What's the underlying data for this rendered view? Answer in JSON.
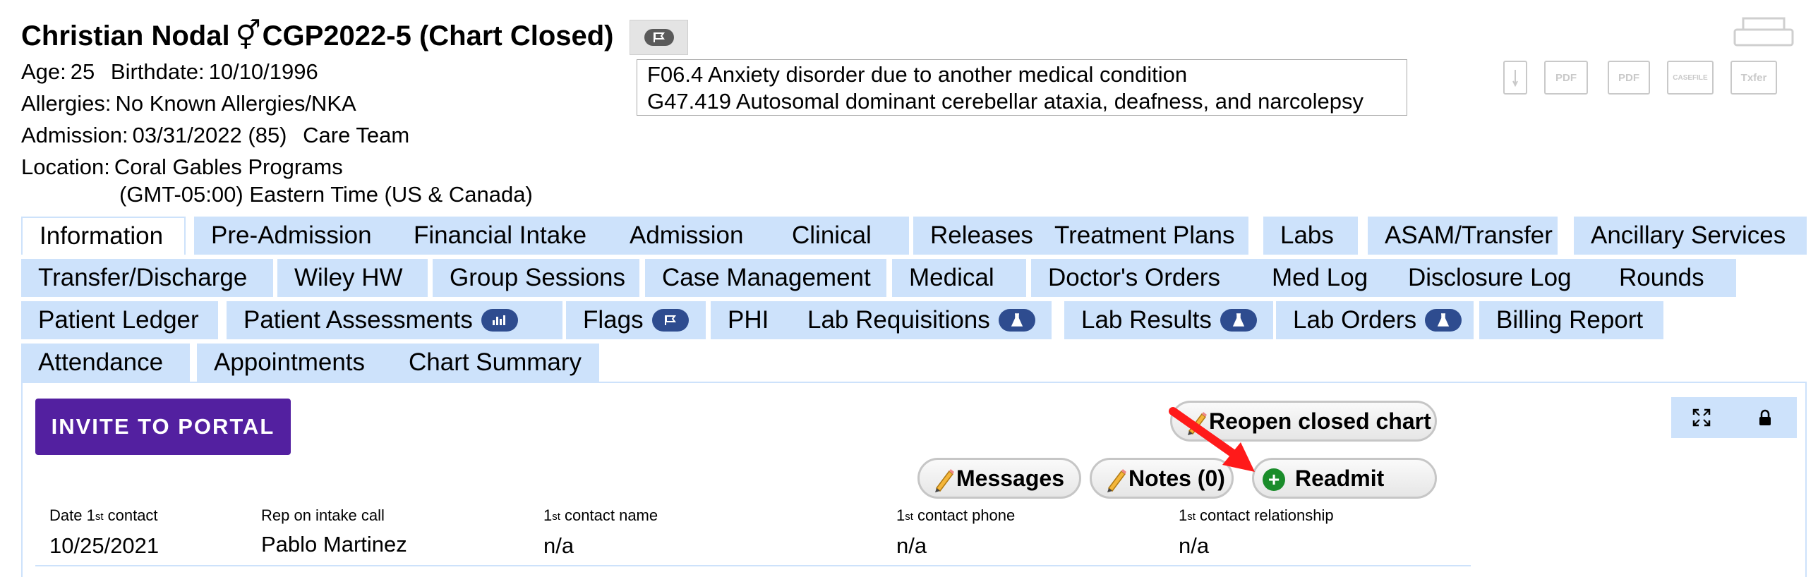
{
  "patient": {
    "name": "Christian Nodal",
    "gender_symbol": "⚥",
    "chart_id": "CGP2022-5 (Chart Closed)",
    "age_label": "Age:",
    "age": "25",
    "birthdate_label": "Birthdate:",
    "birthdate": "10/10/1996",
    "allergies_label": "Allergies:",
    "allergies": "No Known Allergies/NKA",
    "admission_label": "Admission:",
    "admission": "03/31/2022 (85)",
    "care_team": "Care Team",
    "location_label": "Location:",
    "location": "Coral Gables Programs",
    "timezone": "(GMT-05:00) Eastern Time (US & Canada)"
  },
  "diagnoses": [
    "F06.4 Anxiety disorder due to another medical condition",
    "G47.419 Autosomal dominant cerebellar ataxia, deafness, and narcolepsy"
  ],
  "toolbar": {
    "pdf_label": "PDF",
    "pdf2_label": "PDF",
    "casefile_label": "CASEFILE",
    "txfer_label": "Txfer"
  },
  "tabs": {
    "row1": [
      "Information",
      "Pre-Admission",
      "Financial Intake",
      "Admission",
      "Clinical",
      "Releases",
      "Treatment Plans",
      "Labs",
      "ASAM/Transfer",
      "Ancillary Services"
    ],
    "row2": [
      "Transfer/Discharge",
      "Wiley HW",
      "Group Sessions",
      "Case Management",
      "Medical",
      "Doctor's Orders",
      "Med Log",
      "Disclosure Log",
      "Rounds"
    ],
    "row3": [
      "Patient Ledger",
      "Patient Assessments",
      "Flags",
      "PHI",
      "Lab Requisitions",
      "Lab Results",
      "Lab Orders",
      "Billing Report"
    ],
    "row4": [
      "Attendance",
      "Appointments",
      "Chart Summary"
    ]
  },
  "actions": {
    "invite": "INVITE TO PORTAL",
    "reopen": "Reopen closed chart",
    "messages": "Messages",
    "notes": "Notes (0)",
    "readmit": "Readmit",
    "readmit_symbol": "+"
  },
  "intake": {
    "date_first_contact_pre": "Date 1",
    "date_first_contact_sup": "st",
    "date_first_contact_post": " contact",
    "date_first_contact": "10/25/2021",
    "rep_label": "Rep on intake call",
    "rep": "Pablo Martinez",
    "name_label_pre": "1",
    "name_label_sup": "st",
    "name_label_post": " contact name",
    "name": "n/a",
    "phone_label_pre": "1",
    "phone_label_sup": "st",
    "phone_label_post": " contact phone",
    "phone": "n/a",
    "relationship_label_pre": "1",
    "relationship_label_sup": "st",
    "relationship_label_post": " contact relationship",
    "relationship": "n/a"
  },
  "colors": {
    "tab_bg": "#cde2fb",
    "invite_bg": "#5320a0",
    "badge_bg": "#2e4c8f",
    "readmit_icon": "#1a8c2a",
    "annotation_arrow": "#ff1a1a"
  }
}
